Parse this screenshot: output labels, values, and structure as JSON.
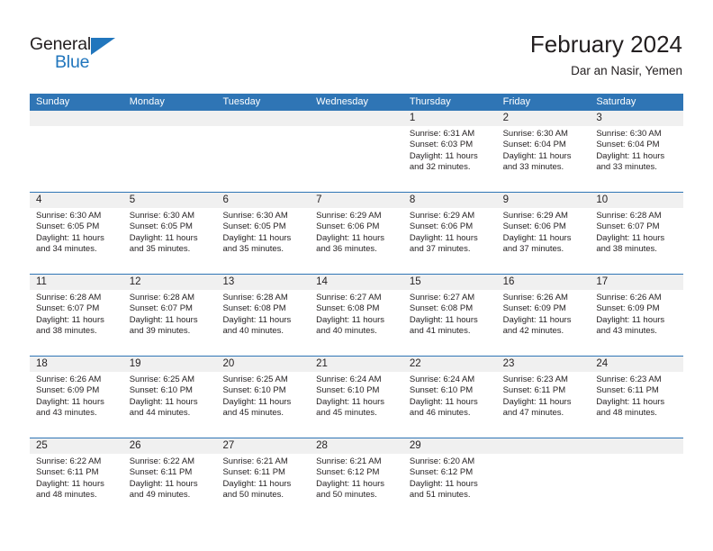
{
  "brand": {
    "name_top": "General",
    "name_bottom": "Blue",
    "accent_color": "#2176bd"
  },
  "header": {
    "title": "February 2024",
    "subtitle": "Dar an Nasir, Yemen"
  },
  "colors": {
    "header_blue": "#2f75b5",
    "daynum_band": "#f0f0f0",
    "text": "#231f20"
  },
  "weekdays": [
    "Sunday",
    "Monday",
    "Tuesday",
    "Wednesday",
    "Thursday",
    "Friday",
    "Saturday"
  ],
  "weeks": [
    [
      {
        "day": "",
        "lines": []
      },
      {
        "day": "",
        "lines": []
      },
      {
        "day": "",
        "lines": []
      },
      {
        "day": "",
        "lines": []
      },
      {
        "day": "1",
        "lines": [
          "Sunrise: 6:31 AM",
          "Sunset: 6:03 PM",
          "Daylight: 11 hours",
          "and 32 minutes."
        ]
      },
      {
        "day": "2",
        "lines": [
          "Sunrise: 6:30 AM",
          "Sunset: 6:04 PM",
          "Daylight: 11 hours",
          "and 33 minutes."
        ]
      },
      {
        "day": "3",
        "lines": [
          "Sunrise: 6:30 AM",
          "Sunset: 6:04 PM",
          "Daylight: 11 hours",
          "and 33 minutes."
        ]
      }
    ],
    [
      {
        "day": "4",
        "lines": [
          "Sunrise: 6:30 AM",
          "Sunset: 6:05 PM",
          "Daylight: 11 hours",
          "and 34 minutes."
        ]
      },
      {
        "day": "5",
        "lines": [
          "Sunrise: 6:30 AM",
          "Sunset: 6:05 PM",
          "Daylight: 11 hours",
          "and 35 minutes."
        ]
      },
      {
        "day": "6",
        "lines": [
          "Sunrise: 6:30 AM",
          "Sunset: 6:05 PM",
          "Daylight: 11 hours",
          "and 35 minutes."
        ]
      },
      {
        "day": "7",
        "lines": [
          "Sunrise: 6:29 AM",
          "Sunset: 6:06 PM",
          "Daylight: 11 hours",
          "and 36 minutes."
        ]
      },
      {
        "day": "8",
        "lines": [
          "Sunrise: 6:29 AM",
          "Sunset: 6:06 PM",
          "Daylight: 11 hours",
          "and 37 minutes."
        ]
      },
      {
        "day": "9",
        "lines": [
          "Sunrise: 6:29 AM",
          "Sunset: 6:06 PM",
          "Daylight: 11 hours",
          "and 37 minutes."
        ]
      },
      {
        "day": "10",
        "lines": [
          "Sunrise: 6:28 AM",
          "Sunset: 6:07 PM",
          "Daylight: 11 hours",
          "and 38 minutes."
        ]
      }
    ],
    [
      {
        "day": "11",
        "lines": [
          "Sunrise: 6:28 AM",
          "Sunset: 6:07 PM",
          "Daylight: 11 hours",
          "and 38 minutes."
        ]
      },
      {
        "day": "12",
        "lines": [
          "Sunrise: 6:28 AM",
          "Sunset: 6:07 PM",
          "Daylight: 11 hours",
          "and 39 minutes."
        ]
      },
      {
        "day": "13",
        "lines": [
          "Sunrise: 6:28 AM",
          "Sunset: 6:08 PM",
          "Daylight: 11 hours",
          "and 40 minutes."
        ]
      },
      {
        "day": "14",
        "lines": [
          "Sunrise: 6:27 AM",
          "Sunset: 6:08 PM",
          "Daylight: 11 hours",
          "and 40 minutes."
        ]
      },
      {
        "day": "15",
        "lines": [
          "Sunrise: 6:27 AM",
          "Sunset: 6:08 PM",
          "Daylight: 11 hours",
          "and 41 minutes."
        ]
      },
      {
        "day": "16",
        "lines": [
          "Sunrise: 6:26 AM",
          "Sunset: 6:09 PM",
          "Daylight: 11 hours",
          "and 42 minutes."
        ]
      },
      {
        "day": "17",
        "lines": [
          "Sunrise: 6:26 AM",
          "Sunset: 6:09 PM",
          "Daylight: 11 hours",
          "and 43 minutes."
        ]
      }
    ],
    [
      {
        "day": "18",
        "lines": [
          "Sunrise: 6:26 AM",
          "Sunset: 6:09 PM",
          "Daylight: 11 hours",
          "and 43 minutes."
        ]
      },
      {
        "day": "19",
        "lines": [
          "Sunrise: 6:25 AM",
          "Sunset: 6:10 PM",
          "Daylight: 11 hours",
          "and 44 minutes."
        ]
      },
      {
        "day": "20",
        "lines": [
          "Sunrise: 6:25 AM",
          "Sunset: 6:10 PM",
          "Daylight: 11 hours",
          "and 45 minutes."
        ]
      },
      {
        "day": "21",
        "lines": [
          "Sunrise: 6:24 AM",
          "Sunset: 6:10 PM",
          "Daylight: 11 hours",
          "and 45 minutes."
        ]
      },
      {
        "day": "22",
        "lines": [
          "Sunrise: 6:24 AM",
          "Sunset: 6:10 PM",
          "Daylight: 11 hours",
          "and 46 minutes."
        ]
      },
      {
        "day": "23",
        "lines": [
          "Sunrise: 6:23 AM",
          "Sunset: 6:11 PM",
          "Daylight: 11 hours",
          "and 47 minutes."
        ]
      },
      {
        "day": "24",
        "lines": [
          "Sunrise: 6:23 AM",
          "Sunset: 6:11 PM",
          "Daylight: 11 hours",
          "and 48 minutes."
        ]
      }
    ],
    [
      {
        "day": "25",
        "lines": [
          "Sunrise: 6:22 AM",
          "Sunset: 6:11 PM",
          "Daylight: 11 hours",
          "and 48 minutes."
        ]
      },
      {
        "day": "26",
        "lines": [
          "Sunrise: 6:22 AM",
          "Sunset: 6:11 PM",
          "Daylight: 11 hours",
          "and 49 minutes."
        ]
      },
      {
        "day": "27",
        "lines": [
          "Sunrise: 6:21 AM",
          "Sunset: 6:11 PM",
          "Daylight: 11 hours",
          "and 50 minutes."
        ]
      },
      {
        "day": "28",
        "lines": [
          "Sunrise: 6:21 AM",
          "Sunset: 6:12 PM",
          "Daylight: 11 hours",
          "and 50 minutes."
        ]
      },
      {
        "day": "29",
        "lines": [
          "Sunrise: 6:20 AM",
          "Sunset: 6:12 PM",
          "Daylight: 11 hours",
          "and 51 minutes."
        ]
      },
      {
        "day": "",
        "lines": []
      },
      {
        "day": "",
        "lines": []
      }
    ]
  ]
}
